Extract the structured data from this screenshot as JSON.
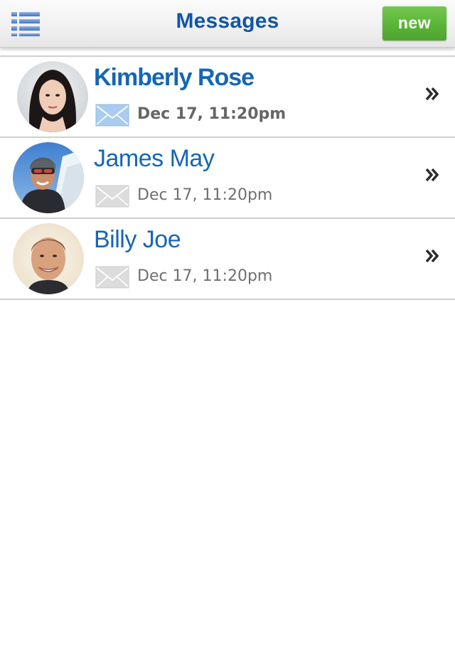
{
  "header": {
    "title": "Messages",
    "new_label": "new",
    "menu_icon": "list-menu-icon"
  },
  "colors": {
    "accent_blue": "#1566b4",
    "title_blue": "#0f57a8",
    "new_button_green": "#58b335",
    "unread_envelope": "#a9ccf0",
    "read_envelope": "#dcdcdc"
  },
  "messages": [
    {
      "name": "Kimberly Rose",
      "date": "Dec 17, 11:20pm",
      "unread": true,
      "avatar": "woman-portrait"
    },
    {
      "name": "James May",
      "date": "Dec 17, 11:20pm",
      "unread": false,
      "avatar": "man-goggles-portrait"
    },
    {
      "name": "Billy Joe",
      "date": "Dec 17, 11:20pm",
      "unread": false,
      "avatar": "man-smiling-portrait"
    }
  ]
}
